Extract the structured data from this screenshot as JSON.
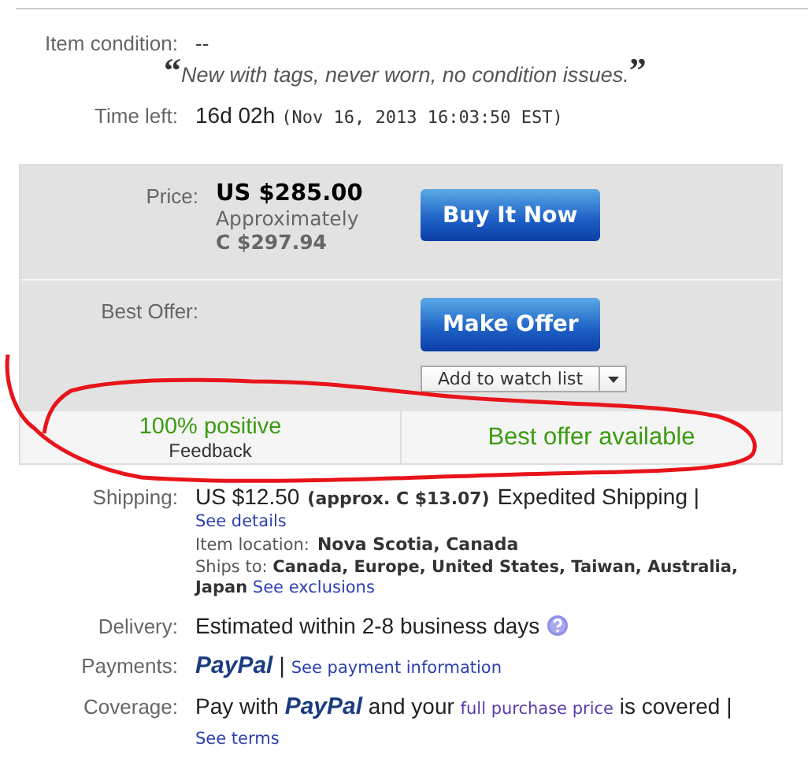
{
  "item_condition": {
    "label": "Item condition:",
    "value": "--",
    "open_quote": "“",
    "description": "New with tags, never worn, no condition issues.",
    "close_quote": "”"
  },
  "time_left": {
    "label": "Time left:",
    "value": "16d 02h",
    "end_date": "(Nov 16, 2013  16:03:50 EST)"
  },
  "price": {
    "label": "Price:",
    "amount": "US $285.00",
    "approx_label": "Approximately",
    "approx_amount": "C $297.94",
    "button": "Buy It Now"
  },
  "best_offer": {
    "label": "Best Offer:",
    "button": "Make Offer",
    "watch_button": "Add to watch list"
  },
  "highlights": {
    "feedback_percent": "100% positive",
    "feedback_label": "Feedback",
    "offer_status": "Best offer available"
  },
  "shipping": {
    "label": "Shipping:",
    "amount": "US $12.50",
    "approx": "(approx. C $13.07)",
    "service": "Expedited Shipping |",
    "details_link": "See details",
    "location_label": "Item location:",
    "location": "Nova Scotia, Canada",
    "ships_to_label": "Ships to:",
    "ships_to": "Canada, Europe, United States, Taiwan, Australia, Japan",
    "exclusions_link": "See exclusions"
  },
  "delivery": {
    "label": "Delivery:",
    "text": "Estimated within 2-8 business days"
  },
  "payments": {
    "label": "Payments:",
    "logo": "PayPal",
    "separator": "|",
    "link": "See payment information"
  },
  "coverage": {
    "label": "Coverage:",
    "before": "Pay with",
    "logo": "PayPal",
    "middle": "and your",
    "link": "full purchase price",
    "after": "is covered |",
    "terms_link": "See terms"
  }
}
